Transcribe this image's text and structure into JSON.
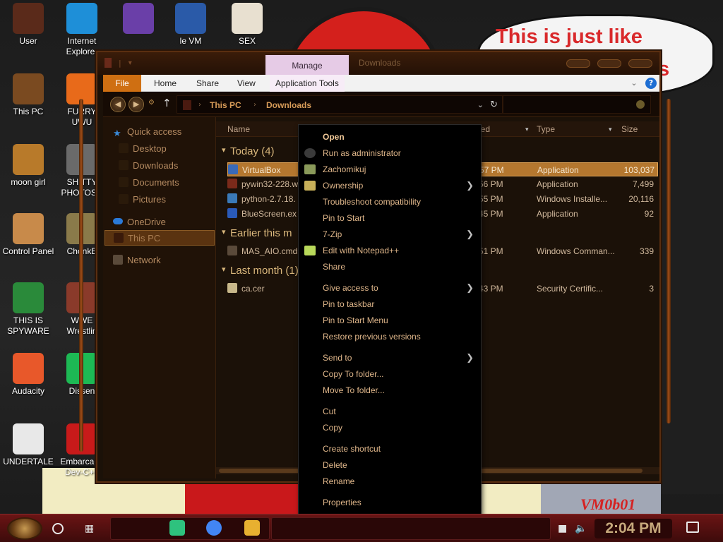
{
  "wallpaper": {
    "bubble_text": "This is just like",
    "bubble_tail": "s",
    "corner_text": "VM0b01"
  },
  "desktop_icons": [
    {
      "label": "User",
      "icon": "user-icon",
      "color": "#5a2a1a"
    },
    {
      "label": "Internet\nExplorer",
      "icon": "edge-icon",
      "color": "#1e8fd8"
    },
    {
      "label": "",
      "icon": "visual-studio-icon",
      "color": "#6a3fa8"
    },
    {
      "label": "le VM",
      "icon": "virtualbox-icon",
      "color": "#2a5aa8"
    },
    {
      "label": "SEX",
      "icon": "hxd-icon",
      "color": "#e8e0d0"
    },
    {
      "label": "This PC",
      "icon": "this-pc-icon",
      "color": "#7a4a20"
    },
    {
      "label": "FURRY\nUWU",
      "icon": "firefox-icon",
      "color": "#e86a1a"
    },
    {
      "label": "moon girl",
      "icon": "moon-girl-icon",
      "color": "#b87a2a"
    },
    {
      "label": "SHITTY\nPHOTOSH",
      "icon": "gimp-icon",
      "color": "#6a6a6a"
    },
    {
      "label": "Control Panel",
      "icon": "control-panel-icon",
      "color": "#c88a4a"
    },
    {
      "label": "ChonkB",
      "icon": "chonkbox-icon",
      "color": "#8a7a4a"
    },
    {
      "label": "THIS IS\nSPYWARE",
      "icon": "chrome-icon",
      "color": "#2a8a3a"
    },
    {
      "label": "WWE\nWrestlin",
      "icon": "wwe-icon",
      "color": "#8a3a2a"
    },
    {
      "label": "Audacity",
      "icon": "audacity-icon",
      "color": "#e8582a"
    },
    {
      "label": "Dissen",
      "icon": "spotify-icon",
      "color": "#1db954"
    },
    {
      "label": "UNDERTALE",
      "icon": "unity-icon",
      "color": "#e8e8e8"
    },
    {
      "label": "Embarcade\nDev-C++",
      "icon": "devcpp-icon",
      "color": "#c81a1a"
    }
  ],
  "explorer": {
    "manage_tab": "Manage",
    "title": "Downloads",
    "ribbon_tabs": [
      "File",
      "Home",
      "Share",
      "View",
      "Application Tools"
    ],
    "help": "?",
    "breadcrumb": [
      "This PC",
      "Downloads"
    ],
    "nav": {
      "quick_access": "Quick access",
      "desktop": "Desktop",
      "downloads": "Downloads",
      "documents": "Documents",
      "pictures": "Pictures",
      "onedrive": "OneDrive",
      "this_pc": "This PC",
      "network": "Network"
    },
    "columns": [
      "Name",
      "ied",
      "Type",
      "Size"
    ],
    "groups": [
      {
        "header": "Today (4)",
        "rows": [
          {
            "name": "VirtualBox",
            "modified": "57 PM",
            "type": "Application",
            "size": "103,037",
            "icon_color": "#3a6ab8",
            "selected": true
          },
          {
            "name": "pywin32-228.w",
            "modified": "56 PM",
            "type": "Application",
            "size": "7,499",
            "icon_color": "#7a2a1a",
            "selected": false
          },
          {
            "name": "python-2.7.18.",
            "modified": "55 PM",
            "type": "Windows Installe...",
            "size": "20,116",
            "icon_color": "#3a7ab8",
            "selected": false
          },
          {
            "name": "BlueScreen.ex",
            "modified": "45 PM",
            "type": "Application",
            "size": "92",
            "icon_color": "#2a5ab8",
            "selected": false
          }
        ]
      },
      {
        "header": "Earlier this m",
        "rows": [
          {
            "name": "MAS_AIO.cmd",
            "modified": "51 PM",
            "type": "Windows Comman...",
            "size": "339",
            "icon_color": "#5a4a3a",
            "selected": false
          }
        ]
      },
      {
        "header": "Last month (1)",
        "rows": [
          {
            "name": "ca.cer",
            "modified": "43 PM",
            "type": "Security Certific...",
            "size": "3",
            "icon_color": "#c8b88a",
            "selected": false
          }
        ]
      }
    ]
  },
  "context_menu": {
    "items": [
      {
        "label": "Open",
        "bold": true,
        "submenu": false,
        "icon": ""
      },
      {
        "label": "Run as administrator",
        "bold": false,
        "submenu": false,
        "icon": "shield-icon"
      },
      {
        "label": "Zachomikuj",
        "bold": false,
        "submenu": false,
        "icon": "hamster-icon"
      },
      {
        "label": "Ownership",
        "bold": false,
        "submenu": true,
        "icon": "ownership-icon"
      },
      {
        "label": "Troubleshoot compatibility",
        "bold": false,
        "submenu": false,
        "icon": ""
      },
      {
        "label": "Pin to Start",
        "bold": false,
        "submenu": false,
        "icon": ""
      },
      {
        "label": "7-Zip",
        "bold": false,
        "submenu": true,
        "icon": ""
      },
      {
        "label": "Edit with Notepad++",
        "bold": false,
        "submenu": false,
        "icon": "notepadpp-icon"
      },
      {
        "label": "Share",
        "bold": false,
        "submenu": false,
        "icon": ""
      },
      {
        "label": "Give access to",
        "bold": false,
        "submenu": true,
        "icon": ""
      },
      {
        "label": "Pin to taskbar",
        "bold": false,
        "submenu": false,
        "icon": ""
      },
      {
        "label": "Pin to Start Menu",
        "bold": false,
        "submenu": false,
        "icon": ""
      },
      {
        "label": "Restore previous versions",
        "bold": false,
        "submenu": false,
        "icon": ""
      },
      {
        "label": "Send to",
        "bold": false,
        "submenu": true,
        "icon": ""
      },
      {
        "label": "Copy To folder...",
        "bold": false,
        "submenu": false,
        "icon": ""
      },
      {
        "label": "Move To folder...",
        "bold": false,
        "submenu": false,
        "icon": ""
      },
      {
        "label": "Cut",
        "bold": false,
        "submenu": false,
        "icon": ""
      },
      {
        "label": "Copy",
        "bold": false,
        "submenu": false,
        "icon": ""
      },
      {
        "label": "Create shortcut",
        "bold": false,
        "submenu": false,
        "icon": ""
      },
      {
        "label": "Delete",
        "bold": false,
        "submenu": false,
        "icon": ""
      },
      {
        "label": "Rename",
        "bold": false,
        "submenu": false,
        "icon": ""
      },
      {
        "label": "Properties",
        "bold": false,
        "submenu": false,
        "icon": ""
      }
    ]
  },
  "taskbar": {
    "time": "2:04 PM",
    "pinned": [
      {
        "icon": "notes-icon",
        "color": "#2ec27e"
      },
      {
        "icon": "chrome-icon",
        "color": "#4285f4"
      },
      {
        "icon": "file-explorer-icon",
        "color": "#e8b030"
      }
    ]
  }
}
